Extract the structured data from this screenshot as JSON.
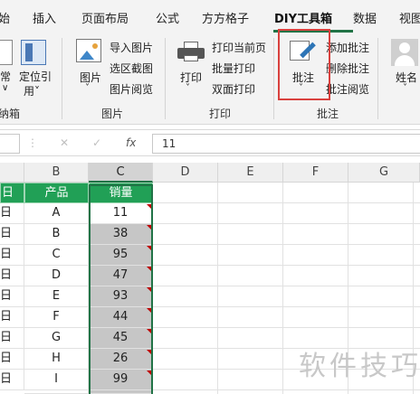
{
  "tabs": [
    "始",
    "插入",
    "页面布局",
    "公式",
    "方方格子",
    "DIY工具箱",
    "数据",
    "视图"
  ],
  "ribbon": {
    "partial_left": {
      "line1": "常",
      "line2": "∨"
    },
    "locate_quote": {
      "line1": "定位引",
      "line2": "用˅"
    },
    "picture_button": {
      "label": "图片",
      "caret": "˅"
    },
    "import_picture": "导入图片",
    "region_screenshot": "选区截图",
    "picture_view": "图片阅览",
    "picture_group": "图片",
    "print_button": {
      "label": "打印",
      "caret": "˅"
    },
    "print_current": "打印当前页",
    "batch_print": "批量打印",
    "duplex_print": "双面打印",
    "print_group": "打印",
    "comment_button": {
      "label": "批注",
      "caret": "˅"
    },
    "add_comment": "添加批注",
    "delete_comment": "删除批注",
    "comment_view": "批注阅览",
    "comment_group": "批注",
    "name_button": {
      "label": "姓名",
      "caret": "˅"
    },
    "left_group": "纳箱"
  },
  "formula_bar": {
    "cancel": "✕",
    "confirm": "✓",
    "fx": "fx",
    "value": "11"
  },
  "columns": [
    "B",
    "C",
    "D",
    "E",
    "F",
    "G"
  ],
  "col_a_cells": [
    "日",
    "日",
    "日",
    "日",
    "日",
    "日",
    "日",
    "日",
    "日",
    "日",
    "日"
  ],
  "headers": {
    "product": "产品",
    "sales": "销量"
  },
  "rows": [
    {
      "product": "A",
      "sales": "11"
    },
    {
      "product": "B",
      "sales": "38"
    },
    {
      "product": "C",
      "sales": "95"
    },
    {
      "product": "D",
      "sales": "47"
    },
    {
      "product": "E",
      "sales": "93"
    },
    {
      "product": "F",
      "sales": "44"
    },
    {
      "product": "G",
      "sales": "45"
    },
    {
      "product": "H",
      "sales": "26"
    },
    {
      "product": "I",
      "sales": "99"
    },
    {
      "product": "J",
      "sales": "23"
    }
  ],
  "watermark": "软件技巧",
  "colors": {
    "accent": "#217346",
    "highlight": "#d9413e",
    "header_fill": "#21a056",
    "comment_marker": "#c00000"
  }
}
